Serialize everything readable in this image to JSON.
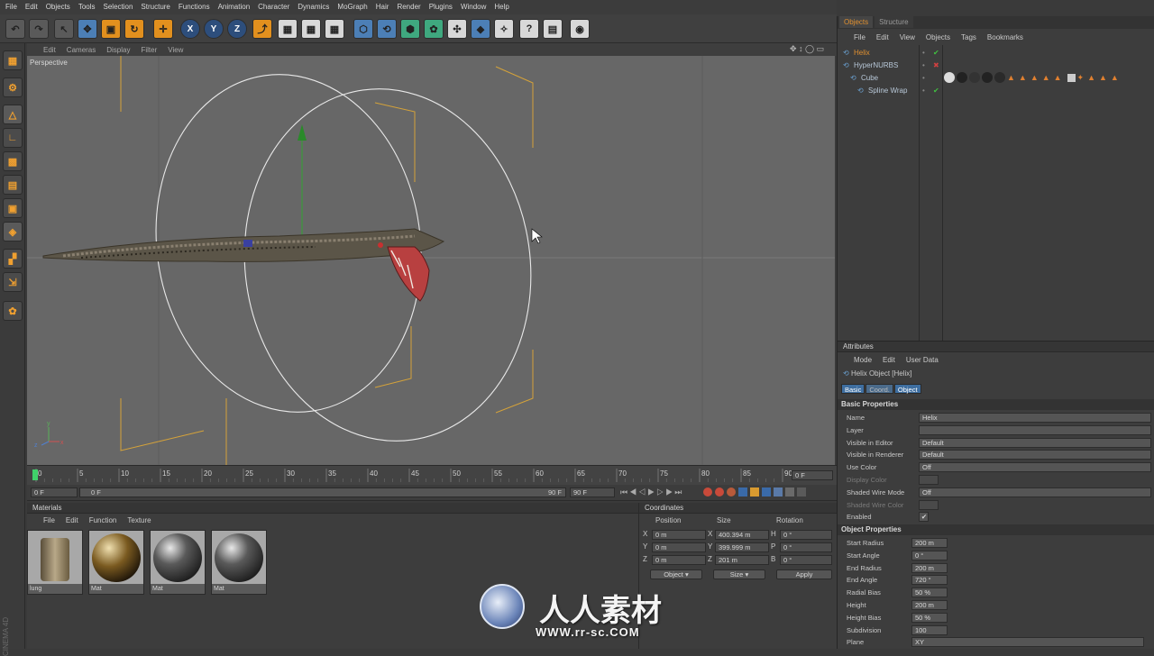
{
  "menu": [
    "File",
    "Edit",
    "Objects",
    "Tools",
    "Selection",
    "Structure",
    "Functions",
    "Animation",
    "Character",
    "Dynamics",
    "MoGraph",
    "Hair",
    "Render",
    "Plugins",
    "Window",
    "Help"
  ],
  "toolbar_icons": [
    "undo-icon",
    "redo-icon",
    "live-select-icon",
    "move-icon",
    "scale-icon",
    "rotate-icon",
    "move-recent-icon",
    "x-axis-icon",
    "y-axis-icon",
    "z-axis-icon",
    "world-coord-icon",
    "render-view-icon",
    "render-picture-viewer-icon",
    "render-settings-icon",
    "cube-icon",
    "spline-icon",
    "nurbs-icon",
    "array-icon",
    "deformer-icon",
    "scene-icon",
    "light-icon",
    "effector-icon",
    "help-icon",
    "layout-icon",
    "browser-icon"
  ],
  "toolbar_axis": {
    "x": "X",
    "y": "Y",
    "z": "Z"
  },
  "viewport": {
    "menu": [
      "Edit",
      "Cameras",
      "Display",
      "Filter",
      "View"
    ],
    "label": "Perspective"
  },
  "timeline": {
    "ticks": [
      "0",
      "5",
      "10",
      "15",
      "20",
      "25",
      "30",
      "35",
      "40",
      "45",
      "50",
      "55",
      "60",
      "65",
      "70",
      "75",
      "80",
      "85",
      "90"
    ],
    "current": "0 F",
    "start": "0 F",
    "min": "0 F",
    "max": "90 F",
    "end": "90 F"
  },
  "materials": {
    "title": "Materials",
    "menu": [
      "File",
      "Edit",
      "Function",
      "Texture"
    ],
    "items": [
      {
        "label": "lung",
        "color": "#8a7a5c"
      },
      {
        "label": "Mat",
        "color": "#5a4a2a"
      },
      {
        "label": "Mat",
        "color": "#3a3a3a"
      },
      {
        "label": "Mat",
        "color": "#3c3c3c"
      }
    ]
  },
  "coordinates": {
    "title": "Coordinates",
    "headers": [
      "Position",
      "Size",
      "Rotation"
    ],
    "rows": [
      {
        "axis": "X",
        "pos": "0 m",
        "size_axis": "X",
        "size": "400.394 m",
        "rot_axis": "H",
        "rot": "0 °"
      },
      {
        "axis": "Y",
        "pos": "0 m",
        "size_axis": "Y",
        "size": "399.999 m",
        "rot_axis": "P",
        "rot": "0 °"
      },
      {
        "axis": "Z",
        "pos": "0 m",
        "size_axis": "Z",
        "size": "201 m",
        "rot_axis": "B",
        "rot": "0 °"
      }
    ],
    "mode1": "Object",
    "mode2": "Size",
    "apply": "Apply"
  },
  "objects": {
    "tabs": [
      "Objects",
      "Structure"
    ],
    "menu": [
      "File",
      "Edit",
      "View",
      "Objects",
      "Tags",
      "Bookmarks"
    ],
    "tree": [
      {
        "name": "Helix",
        "indent": 0,
        "active": true,
        "check": "✔"
      },
      {
        "name": "HyperNURBS",
        "indent": 0,
        "active": false,
        "check": "✖"
      },
      {
        "name": "Cube",
        "indent": 1,
        "active": false,
        "check": ""
      },
      {
        "name": "Spline Wrap",
        "indent": 2,
        "active": false,
        "check": "✔"
      }
    ]
  },
  "attributes": {
    "title": "Attributes",
    "menu": [
      "Mode",
      "Edit",
      "User Data"
    ],
    "object_title": "Helix Object [Helix]",
    "tabs": [
      "Basic",
      "Coord.",
      "Object"
    ],
    "basic_section": "Basic Properties",
    "basic": [
      {
        "label": "Name",
        "value": "Helix",
        "dim": false
      },
      {
        "label": "Layer",
        "value": "",
        "dim": false
      },
      {
        "label": "Visible in Editor",
        "value": "Default",
        "dim": false
      },
      {
        "label": "Visible in Renderer",
        "value": "Default",
        "dim": false
      },
      {
        "label": "Use Color",
        "value": "Off",
        "dim": false
      },
      {
        "label": "Display Color",
        "value": "",
        "dim": true
      },
      {
        "label": "Shaded Wire Mode",
        "value": "Off",
        "dim": false
      },
      {
        "label": "Shaded Wire Color",
        "value": "",
        "dim": true
      },
      {
        "label": "Enabled",
        "value": "✔",
        "dim": false
      }
    ],
    "object_section": "Object Properties",
    "object": [
      {
        "label": "Start Radius",
        "value": "200 m"
      },
      {
        "label": "Start Angle",
        "value": "0 °"
      },
      {
        "label": "End Radius",
        "value": "200 m"
      },
      {
        "label": "End Angle",
        "value": "720 °"
      },
      {
        "label": "Radial Bias",
        "value": "50 %"
      },
      {
        "label": "Height",
        "value": "200 m"
      },
      {
        "label": "Height Bias",
        "value": "50 %"
      },
      {
        "label": "Subdivision",
        "value": "100"
      },
      {
        "label": "Plane",
        "value": "XY"
      }
    ]
  },
  "watermark": {
    "line1": "人人素材",
    "line2": "WWW.rr-sc.COM"
  },
  "side_brand": "CINEMA 4D"
}
